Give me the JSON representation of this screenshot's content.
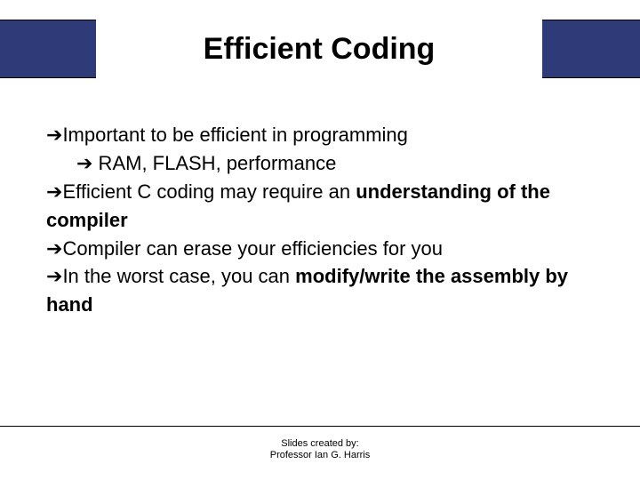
{
  "title": "Efficient Coding",
  "glyph": "➔",
  "bullets": {
    "b1": "Important to be efficient in programming",
    "b1a": " RAM, FLASH, performance",
    "b2_pre": "Efficient C coding may require an ",
    "b2_bold": "understanding of the compiler",
    "b3": "Compiler can erase your efficiencies for you",
    "b4_pre": "In the worst case, you can ",
    "b4_bold": "modify/write the assembly by hand"
  },
  "footer": {
    "line1": "Slides created by:",
    "line2": "Professor Ian G. Harris"
  }
}
